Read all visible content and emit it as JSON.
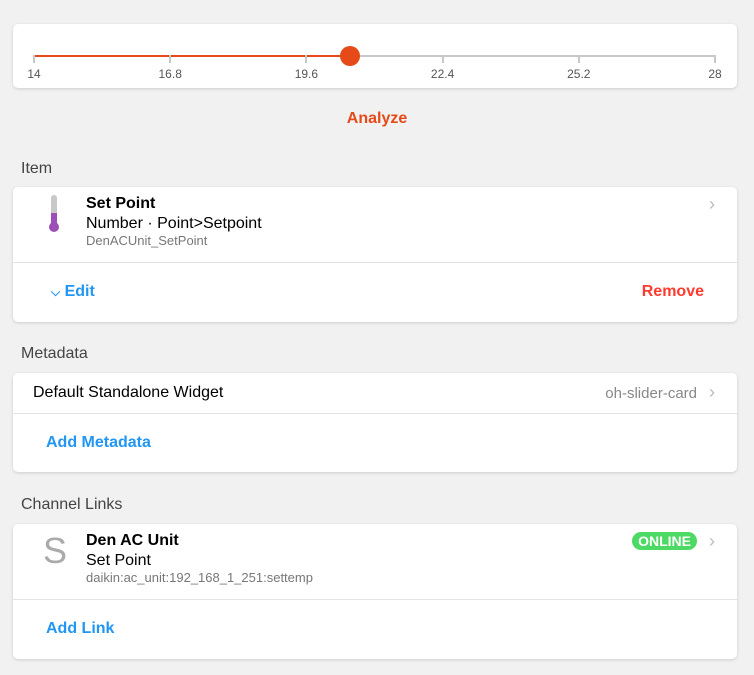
{
  "slider": {
    "min": 14,
    "max": 28,
    "value": 20.5,
    "ticks": [
      "14",
      "16.8",
      "19.6",
      "22.4",
      "25.2",
      "28"
    ],
    "accent": "#e64a19"
  },
  "analyze_label": "Analyze",
  "item_section": {
    "heading": "Item",
    "title": "Set Point",
    "type": "Number · Point>Setpoint",
    "name": "DenACUnit_SetPoint",
    "edit_label": "Edit",
    "remove_label": "Remove"
  },
  "metadata_section": {
    "heading": "Metadata",
    "entry_label": "Default Standalone Widget",
    "entry_value": "oh-slider-card",
    "add_label": "Add Metadata"
  },
  "channel_section": {
    "heading": "Channel Links",
    "icon_letter": "S",
    "thing": "Den AC Unit",
    "channel": "Set Point",
    "uid": "daikin:ac_unit:192_168_1_251:settemp",
    "status": "ONLINE",
    "add_label": "Add Link"
  }
}
